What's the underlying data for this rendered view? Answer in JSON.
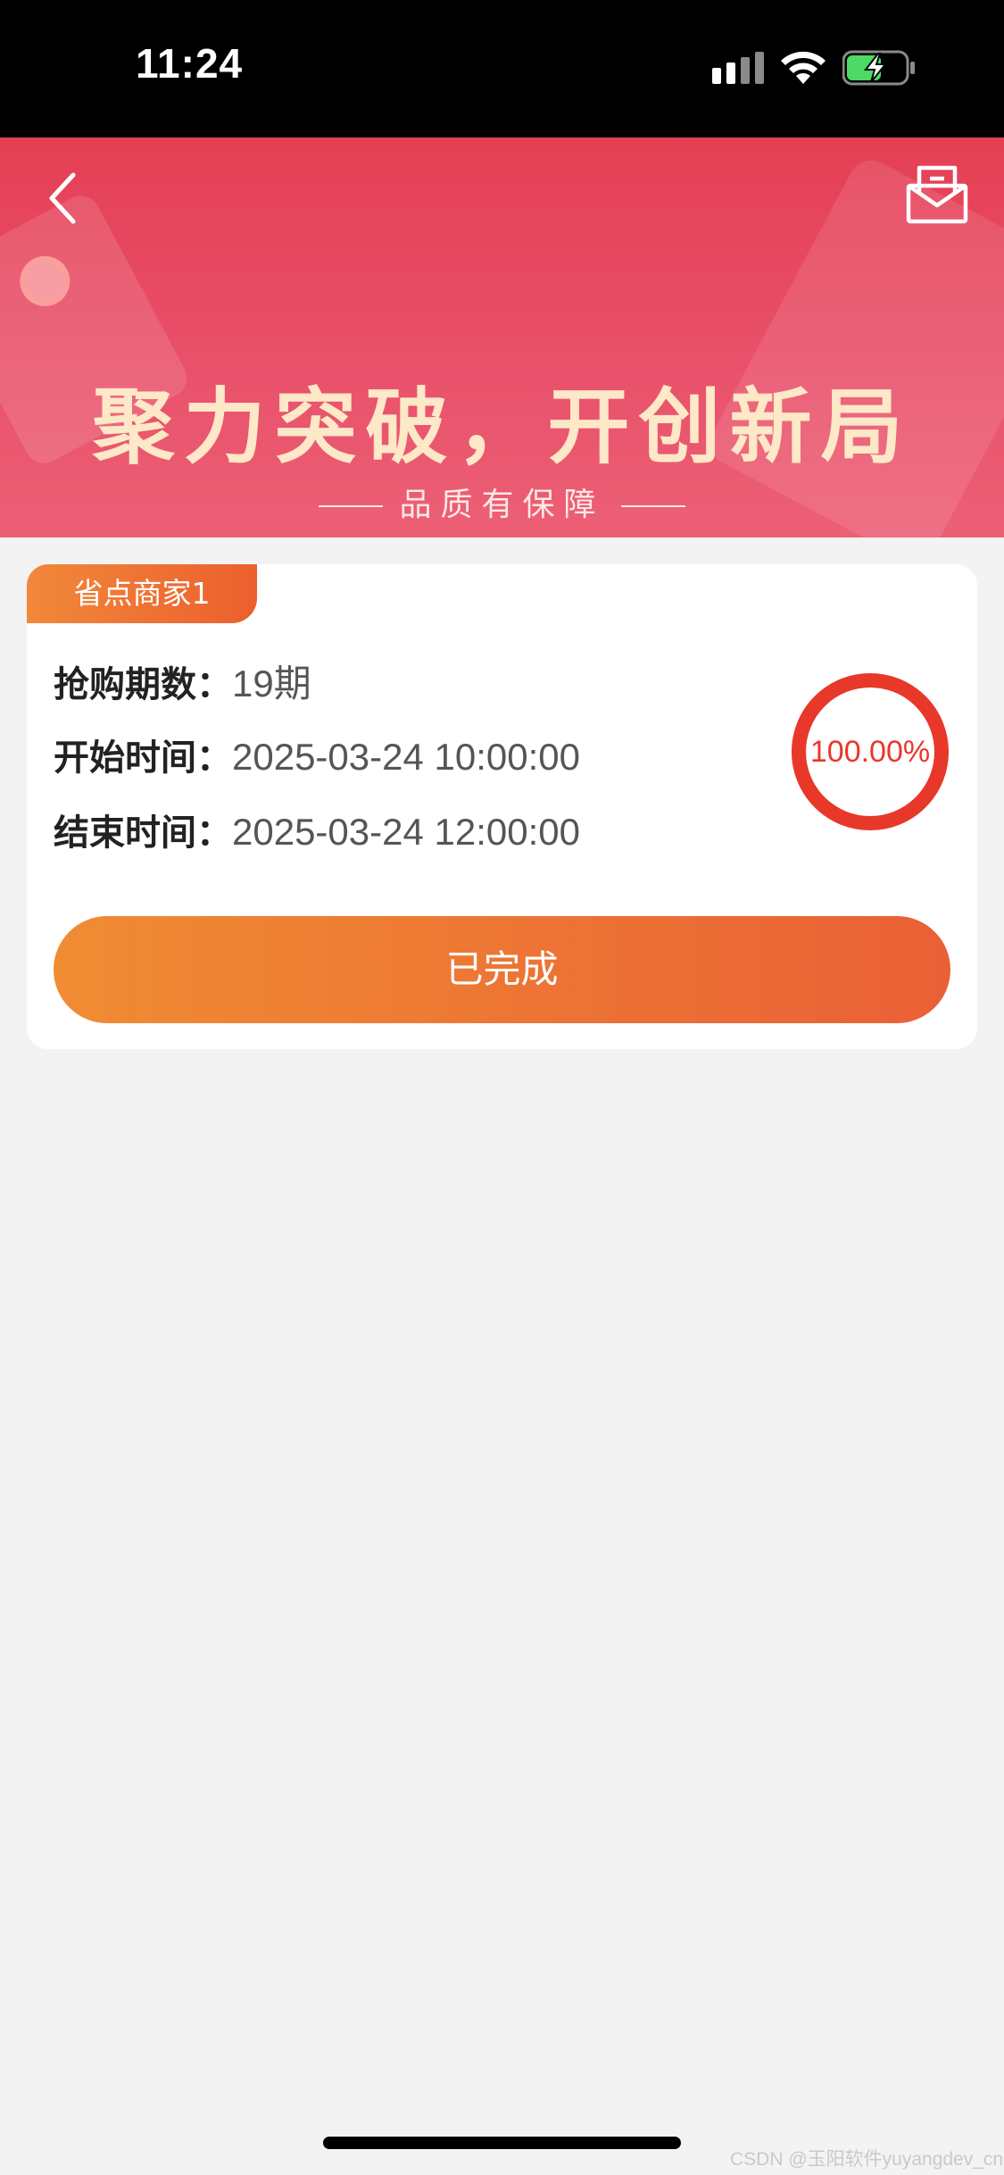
{
  "status_bar": {
    "time": "11:24"
  },
  "banner": {
    "title": "聚力突破，开创新局",
    "subtitle": "品质有保障"
  },
  "card": {
    "merchant_name": "省点商家1",
    "rows": [
      {
        "label": "抢购期数：",
        "value": "19期"
      },
      {
        "label": "开始时间：",
        "value": "2025-03-24 10:00:00"
      },
      {
        "label": "结束时间：",
        "value": "2025-03-24 12:00:00"
      }
    ],
    "progress": {
      "fraction": 1.0,
      "label": "100.00%"
    },
    "action_button": "已完成"
  },
  "watermark": "CSDN @玉阳软件yuyangdev_cn",
  "colors": {
    "accent_orange": "#ec6a34",
    "ring_red": "#e8382a",
    "banner_red": "#e84a60",
    "banner_text": "#fde8c8"
  },
  "icons": {
    "back": "chevron-left-icon",
    "mail": "envelope-open-icon",
    "signal": "cellular-signal-icon",
    "wifi": "wifi-icon",
    "battery": "battery-charging-icon"
  }
}
